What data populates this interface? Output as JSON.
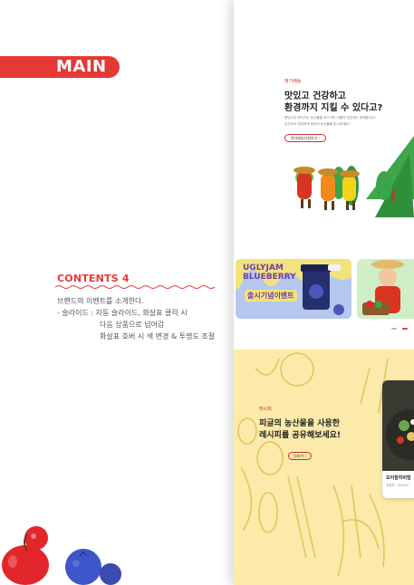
{
  "section_tag": "MAIN",
  "contents": {
    "title": "CONTENTS 4",
    "line1": "브랜드의 이벤트를 소개한다.",
    "line2": "- 슬라이드 :  자동 슬라이드, 화살표 클릭 시",
    "line3": "다음 상품으로 넘어감",
    "line4": "화살표 호버 시 색 변경 & 투명도 조절"
  },
  "preview": {
    "hero_label": "정기배송",
    "hero_title_1": "맛있고 건강하고",
    "hero_title_2": "환경까지 지킬 수 있다고?",
    "hero_body_1": "못난이고 하자가는 농산물을 모으고만 다릅지 맛있게는 판매합니다!",
    "hero_body_2": "신선하고 건강하게 못난이 농산물을 만나보세요!",
    "hero_button": "정기배송신청하기",
    "event_card_text_1": "UGLYJAM",
    "event_card_text_2": "BLUEBERRY",
    "event_card_badge": "출시기념이벤트",
    "recipe_label": "레시피",
    "recipe_title_1": "피글의 농산물을 사용한",
    "recipe_title_2": "레시피를 공유해보세요!",
    "recipe_button": "더보기",
    "recipe_card_title": "오이참치비빔",
    "recipe_card_meta": "작성자 · 2024.0"
  },
  "colors": {
    "accent": "#e53935",
    "recipe_bg": "#fbeaa9",
    "card_blue": "#b6c8f0",
    "card_green": "#cfeec8"
  }
}
